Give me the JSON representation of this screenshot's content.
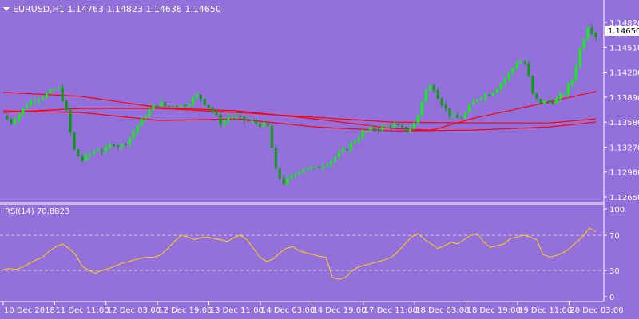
{
  "window": {
    "menu_icon": "triangle-down-icon",
    "header_text": "EURUSD,H1  1.14763 1.14823 1.14636 1.14650"
  },
  "main_chart": {
    "price_scale": [
      "1.14820",
      "1.14510",
      "1.14200",
      "1.13890",
      "1.13580",
      "1.13270",
      "1.12960",
      "1.12650"
    ],
    "current_price_label": "1.14650",
    "grid": false
  },
  "rsi": {
    "label": "RSI(14) 70.8823",
    "scale": [
      "100",
      "70",
      "30",
      "0"
    ],
    "levels": [
      70,
      30
    ]
  },
  "time_axis": [
    "10 Dec 2018",
    "11 Dec 11:00",
    "12 Dec 03:00",
    "12 Dec 19:00",
    "13 Dec 11:00",
    "14 Dec 03:00",
    "14 Dec 19:00",
    "17 Dec 11:00",
    "18 Dec 03:00",
    "18 Dec 19:00",
    "19 Dec 11:00",
    "20 Dec 03:00"
  ],
  "colors": {
    "background": "#9370DB",
    "bull_candle": "#00FF00",
    "bear_candle": "#00A000",
    "moving_averages": "#FF0000",
    "rsi_line": "#FFD700",
    "axis_text": "#FFFFFF"
  },
  "chart_data": [
    {
      "type": "candlestick",
      "symbol": "EURUSD",
      "timeframe": "H1",
      "ohlc_last": {
        "open": 1.14763,
        "high": 1.14823,
        "low": 1.14636,
        "close": 1.1465
      },
      "ylim": [
        1.1262,
        1.149
      ],
      "x": [
        "10 Dec 2018",
        "11 Dec 11:00",
        "12 Dec 03:00",
        "12 Dec 19:00",
        "13 Dec 11:00",
        "14 Dec 03:00",
        "14 Dec 19:00",
        "17 Dec 11:00",
        "18 Dec 03:00",
        "18 Dec 19:00",
        "19 Dec 11:00",
        "20 Dec 03:00"
      ],
      "close_path": [
        [
          0,
          1.1365
        ],
        [
          1,
          1.1358
        ],
        [
          2,
          1.1368
        ],
        [
          3,
          1.138
        ],
        [
          4,
          1.1387
        ],
        [
          5,
          1.139
        ],
        [
          6,
          1.1395
        ],
        [
          7,
          1.1402
        ],
        [
          8,
          1.1376
        ],
        [
          9,
          1.1325
        ],
        [
          10,
          1.131
        ],
        [
          11,
          1.1318
        ],
        [
          12,
          1.1325
        ],
        [
          13,
          1.1322
        ],
        [
          14,
          1.1332
        ],
        [
          15,
          1.1328
        ],
        [
          16,
          1.1336
        ],
        [
          17,
          1.135
        ],
        [
          18,
          1.1364
        ],
        [
          19,
          1.1375
        ],
        [
          20,
          1.1382
        ],
        [
          21,
          1.1377
        ],
        [
          22,
          1.138
        ],
        [
          23,
          1.1378
        ],
        [
          24,
          1.1385
        ],
        [
          25,
          1.1392
        ],
        [
          26,
          1.138
        ],
        [
          27,
          1.137
        ],
        [
          28,
          1.1355
        ],
        [
          29,
          1.1365
        ],
        [
          30,
          1.1363
        ],
        [
          31,
          1.136
        ],
        [
          32,
          1.1358
        ],
        [
          33,
          1.1355
        ],
        [
          34,
          1.1352
        ],
        [
          35,
          1.1295
        ],
        [
          36,
          1.1282
        ],
        [
          37,
          1.129
        ],
        [
          38,
          1.1298
        ],
        [
          39,
          1.1302
        ],
        [
          40,
          1.13
        ],
        [
          41,
          1.1305
        ],
        [
          42,
          1.131
        ],
        [
          43,
          1.1318
        ],
        [
          44,
          1.1325
        ],
        [
          45,
          1.1335
        ],
        [
          46,
          1.1345
        ],
        [
          47,
          1.1348
        ],
        [
          48,
          1.135
        ],
        [
          49,
          1.1352
        ],
        [
          50,
          1.1355
        ],
        [
          51,
          1.135
        ],
        [
          52,
          1.1348
        ],
        [
          53,
          1.136
        ],
        [
          54,
          1.1395
        ],
        [
          55,
          1.1405
        ],
        [
          56,
          1.1385
        ],
        [
          57,
          1.137
        ],
        [
          58,
          1.1362
        ],
        [
          59,
          1.1365
        ],
        [
          60,
          1.138
        ],
        [
          61,
          1.139
        ],
        [
          62,
          1.1392
        ],
        [
          63,
          1.1398
        ],
        [
          64,
          1.1408
        ],
        [
          65,
          1.142
        ],
        [
          66,
          1.1435
        ],
        [
          67,
          1.143
        ],
        [
          68,
          1.1388
        ],
        [
          69,
          1.1382
        ],
        [
          70,
          1.1383
        ],
        [
          71,
          1.1386
        ],
        [
          72,
          1.1395
        ],
        [
          73,
          1.1412
        ],
        [
          74,
          1.145
        ],
        [
          75,
          1.1478
        ],
        [
          76,
          1.1465
        ]
      ],
      "moving_averages": [
        {
          "points": [
            [
              0,
              1.1395
            ],
            [
              10,
              1.139
            ],
            [
              20,
              1.1376
            ],
            [
              30,
              1.1372
            ],
            [
              40,
              1.1362
            ],
            [
              50,
              1.135
            ],
            [
              55,
              1.1348
            ],
            [
              60,
              1.1362
            ],
            [
              70,
              1.1383
            ],
            [
              76,
              1.1396
            ]
          ]
        },
        {
          "points": [
            [
              0,
              1.137
            ],
            [
              10,
              1.1375
            ],
            [
              20,
              1.1375
            ],
            [
              30,
              1.137
            ],
            [
              40,
              1.1364
            ],
            [
              50,
              1.1358
            ],
            [
              60,
              1.1357
            ],
            [
              70,
              1.1357
            ],
            [
              76,
              1.1362
            ]
          ]
        },
        {
          "points": [
            [
              0,
              1.1372
            ],
            [
              10,
              1.137
            ],
            [
              20,
              1.136
            ],
            [
              30,
              1.1362
            ],
            [
              40,
              1.1352
            ],
            [
              50,
              1.1347
            ],
            [
              60,
              1.1348
            ],
            [
              70,
              1.1352
            ],
            [
              76,
              1.1358
            ]
          ]
        }
      ]
    },
    {
      "type": "line",
      "title": "RSI(14) 70.8823",
      "ylim": [
        0,
        100
      ],
      "levels": [
        70,
        30
      ],
      "series": [
        {
          "values": [
            31,
            32,
            31,
            34,
            38,
            42,
            45,
            52,
            57,
            60,
            55,
            48,
            35,
            30,
            27,
            30,
            32,
            35,
            38,
            40,
            42,
            44,
            45,
            45,
            48,
            55,
            63,
            70,
            68,
            65,
            67,
            68,
            66,
            65,
            63,
            67,
            70,
            65,
            55,
            45,
            40,
            43,
            50,
            55,
            57,
            52,
            50,
            48,
            46,
            45,
            22,
            20,
            22,
            30,
            34,
            36,
            38,
            40,
            42,
            45,
            52,
            60,
            68,
            72,
            65,
            60,
            55,
            58,
            62,
            60,
            65,
            70,
            72,
            62,
            56,
            58,
            60,
            66,
            68,
            70,
            68,
            65,
            48,
            45,
            47,
            50,
            55,
            62,
            68,
            78,
            74
          ]
        }
      ]
    }
  ]
}
